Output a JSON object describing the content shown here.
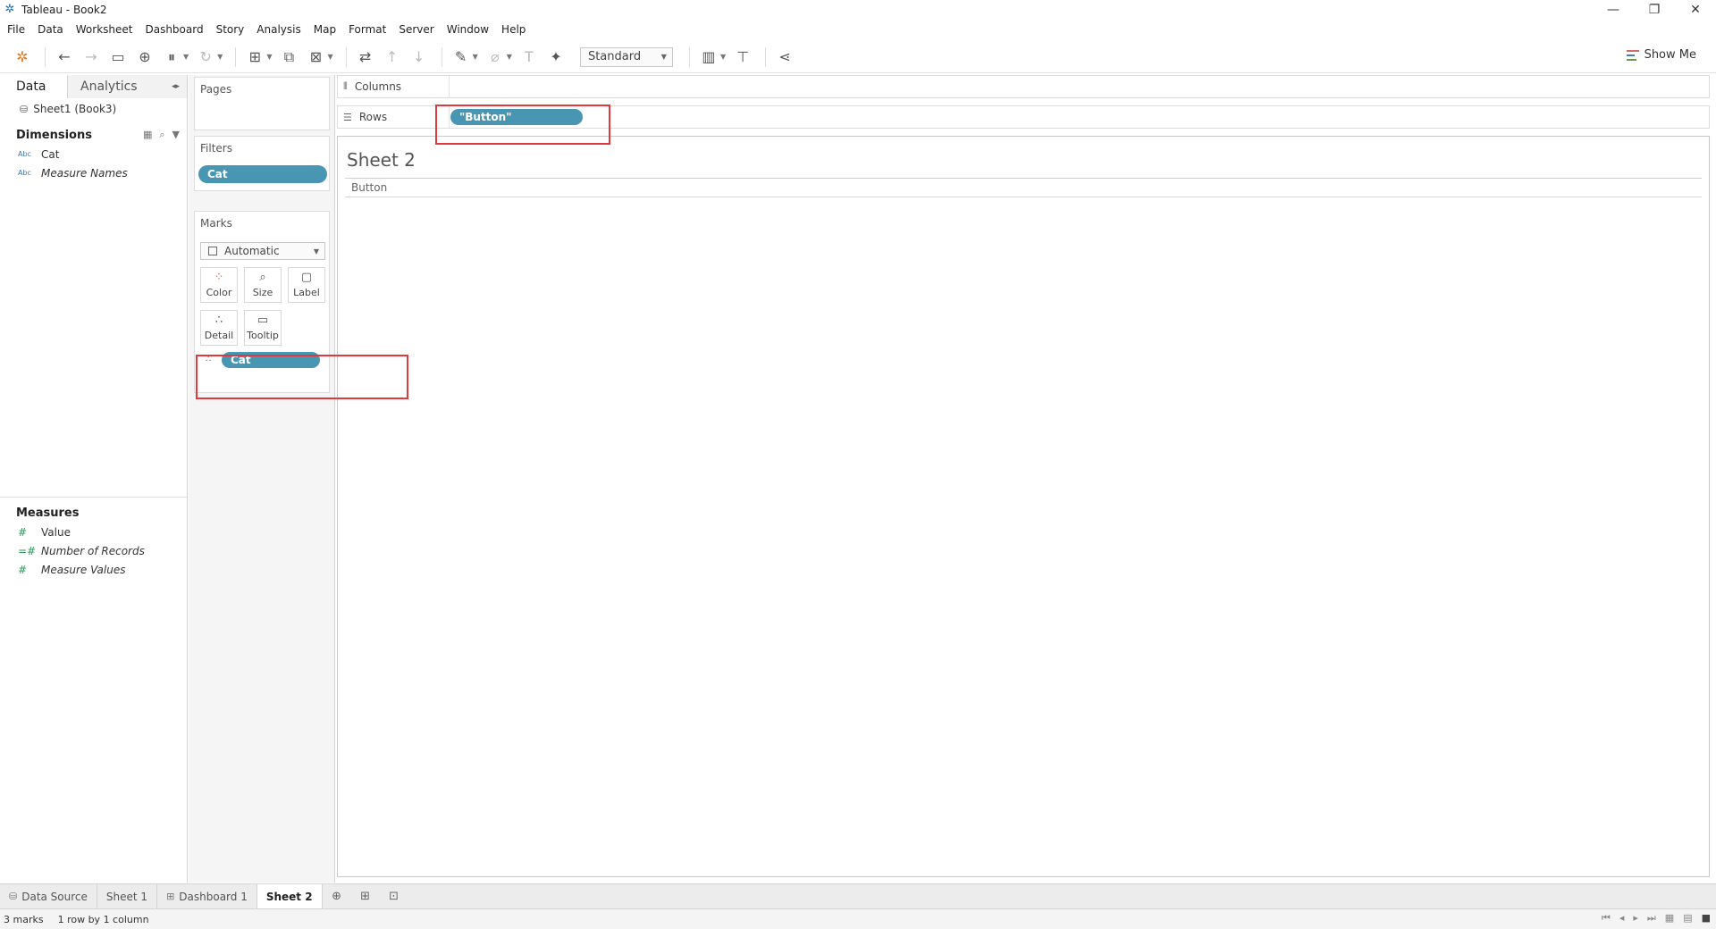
{
  "window": {
    "title": "Tableau - Book2",
    "minimize": "—",
    "restore": "❐",
    "close": "✕"
  },
  "menu": [
    "File",
    "Data",
    "Worksheet",
    "Dashboard",
    "Story",
    "Analysis",
    "Map",
    "Format",
    "Server",
    "Window",
    "Help"
  ],
  "toolbar": {
    "fit_value": "Standard",
    "show_me": "Show Me"
  },
  "datapane": {
    "tab_data": "Data",
    "tab_analytics": "Analytics",
    "source": "Sheet1 (Book3)",
    "dimensions_label": "Dimensions",
    "dimensions": [
      {
        "type": "Abc",
        "name": "Cat"
      },
      {
        "type": "Abc",
        "name": "Measure Names"
      }
    ],
    "measures_label": "Measures",
    "measures": [
      {
        "type": "#",
        "name": "Value"
      },
      {
        "type": "=#",
        "name": "Number of Records"
      },
      {
        "type": "#",
        "name": "Measure Values"
      }
    ]
  },
  "cards": {
    "pages_label": "Pages",
    "filters_label": "Filters",
    "filter_pill": "Cat",
    "marks_label": "Marks",
    "mark_type": "Automatic",
    "buttons": [
      "Color",
      "Size",
      "Label",
      "Detail",
      "Tooltip"
    ],
    "detail_pill": "Cat"
  },
  "shelves": {
    "columns_label": "Columns",
    "rows_label": "Rows",
    "rows_pill": "\"Button\""
  },
  "canvas": {
    "sheet_title": "Sheet 2",
    "row_header": "Button"
  },
  "tabs": {
    "data_source": "Data Source",
    "sheets": [
      "Sheet 1",
      "Dashboard 1",
      "Sheet 2"
    ]
  },
  "status": {
    "marks": "3 marks",
    "layout": "1 row by 1 column"
  },
  "colors": {
    "pill": "#4996b2",
    "annotation": "#e0383e"
  }
}
